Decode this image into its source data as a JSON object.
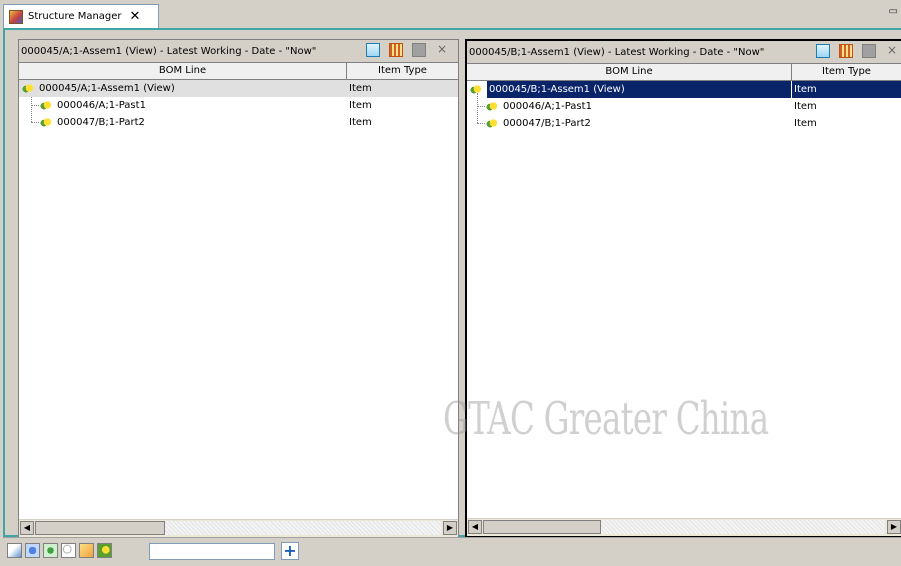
{
  "app": {
    "tab_title": "Structure Manager"
  },
  "left_pane": {
    "title": "000045/A;1-Assem1 (View) - Latest Working - Date - \"Now\"",
    "col_bom": "BOM Line",
    "col_type": "Item Type",
    "rows": [
      {
        "name": "000045/A;1-Assem1 (View)",
        "type": "Item"
      },
      {
        "name": "000046/A;1-Past1",
        "type": "Item"
      },
      {
        "name": "000047/B;1-Part2",
        "type": "Item"
      }
    ]
  },
  "right_pane": {
    "title": "000045/B;1-Assem1 (View) - Latest Working - Date - \"Now\"",
    "col_bom": "BOM Line",
    "col_type": "Item Type",
    "rows": [
      {
        "name": "000045/B;1-Assem1 (View)",
        "type": "Item"
      },
      {
        "name": "000046/A;1-Past1",
        "type": "Item"
      },
      {
        "name": "000047/B;1-Part2",
        "type": "Item"
      }
    ]
  },
  "toolbar_icons": [
    "new-icon",
    "grid-icon",
    "save-icon",
    "close-icon"
  ],
  "bottom_icons": [
    "import-icon",
    "swap-icon",
    "refresh-icon",
    "find-icon",
    "expand-icon",
    "assembly-icon"
  ],
  "search": {
    "value": ""
  },
  "watermark": "GTAC Greater China",
  "colors": {
    "selection": "#0a246a",
    "frame": "#3fa5a5"
  }
}
